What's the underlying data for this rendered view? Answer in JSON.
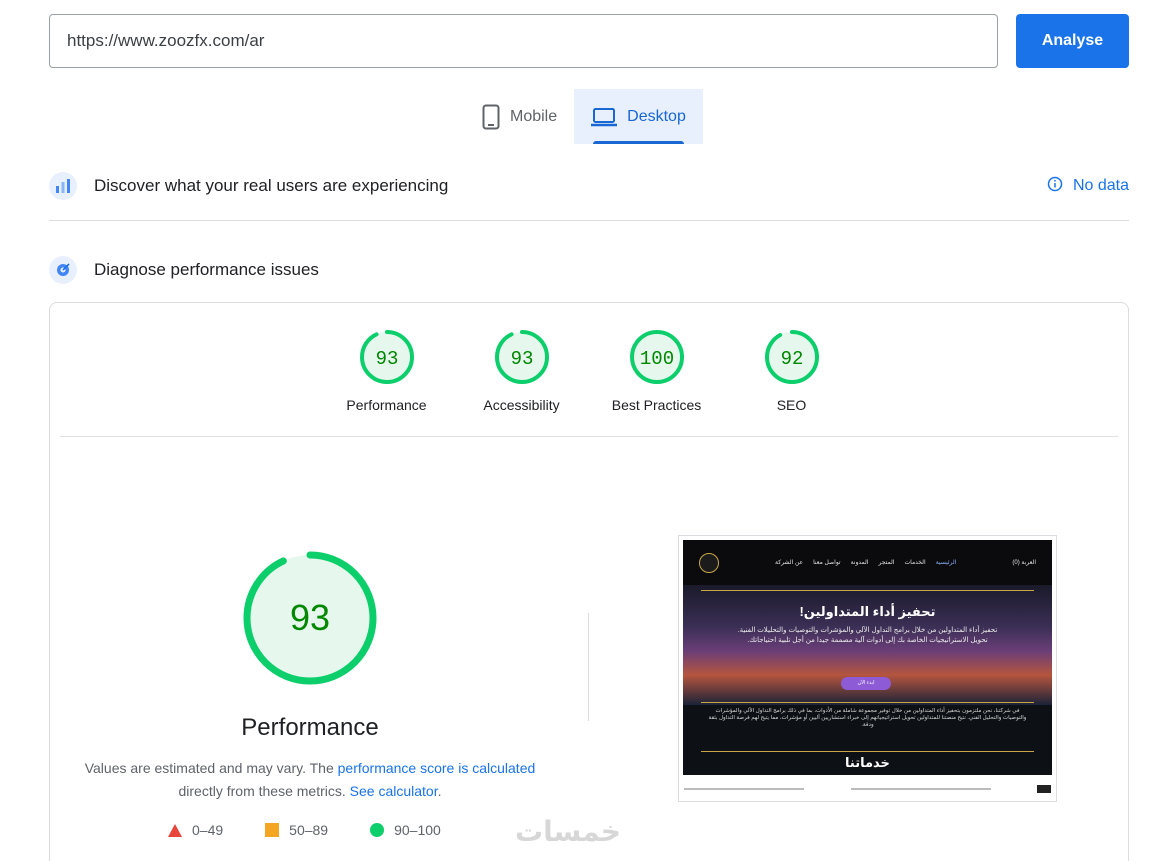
{
  "url_bar": {
    "value": "https://www.zoozfx.com/ar"
  },
  "analyse_button": {
    "label": "Analyse"
  },
  "tabs": [
    {
      "label": "Mobile",
      "icon": "phone-icon",
      "active": false
    },
    {
      "label": "Desktop",
      "icon": "laptop-icon",
      "active": true
    }
  ],
  "field_data": {
    "title": "Discover what your real users are experiencing",
    "status": "No data"
  },
  "lab_data": {
    "title": "Diagnose performance issues"
  },
  "scores": [
    {
      "label": "Performance",
      "value": "93",
      "fraction": 0.93
    },
    {
      "label": "Accessibility",
      "value": "93",
      "fraction": 0.93
    },
    {
      "label": "Best Practices",
      "value": "100",
      "fraction": 1.0
    },
    {
      "label": "SEO",
      "value": "92",
      "fraction": 0.92
    }
  ],
  "main_score": {
    "value": "93",
    "fraction": 0.93,
    "title": "Performance"
  },
  "description": {
    "text1": "Values are estimated and may vary. The ",
    "link1": "performance score is calculated",
    "text2": "directly from these metrics. ",
    "link2": "See calculator",
    "text3": "."
  },
  "legend": [
    {
      "range": "0–49",
      "shape": "triangle",
      "color": "#e8453c"
    },
    {
      "range": "50–89",
      "shape": "square",
      "color": "#f5a623"
    },
    {
      "range": "90–100",
      "shape": "circle",
      "color": "#0cce6b"
    }
  ],
  "screenshot": {
    "nav_cart": "العربة (0)",
    "nav_links": [
      "الرئيسية",
      "الخدمات",
      "المتجر",
      "المدونة",
      "تواصل معنا",
      "عن الشركة"
    ],
    "hero_title": "تحفيز أداء المتداولين!",
    "hero_text": "تحفيز أداء المتداولين من خلال برامج التداول الآلي والمؤشرات والتوصيات والتحليلات الفنية. تحويل الاستراتيجيات الخاصة بك إلى أدوات آلية مصممة جيدا من أجل تلبية احتياجاتك.",
    "hero_button": "ابدء الآن",
    "body_text": "في شركتنا، نحن ملتزمون بتحفيز أداء المتداولين من خلال توفير مجموعة شاملة من الأدوات، بما في ذلك برامج التداول الآلي والمؤشرات والتوصيات والتحليل الفني. نتيح منصتنا للمتداولين تحويل استراتيجياتهم إلى خبراء استشاريين آليين أو مؤشرات، مما يتيح لهم فرصة التداول بثقة ودقة.",
    "section_title": "خدماتنا"
  },
  "watermark": "خمسات",
  "colors": {
    "good": "#0cce6b",
    "good_text": "#008800",
    "good_fill": "#e6f8ee",
    "accent": "#1a73e8"
  }
}
